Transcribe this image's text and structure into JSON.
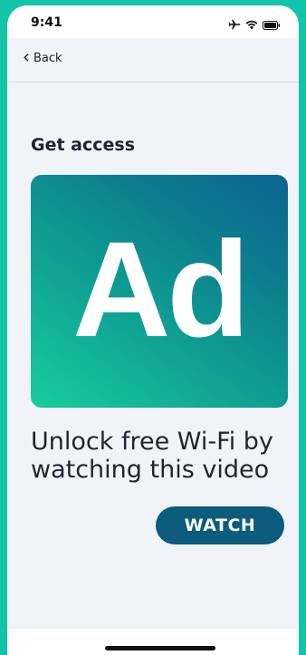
{
  "status_bar": {
    "time": "9:41",
    "icons": [
      "airplane-icon",
      "wifi-icon",
      "battery-icon"
    ]
  },
  "nav": {
    "back_label": "Back"
  },
  "main": {
    "title": "Get access",
    "ad_label": "Ad",
    "headline": "Unlock free Wi-Fi by watching this video",
    "watch_label": "WATCH"
  },
  "colors": {
    "frame": "#12c4aa",
    "background": "#f0f3f7",
    "button": "#0d5b7d",
    "card_gradient_start": "#18cc9c",
    "card_gradient_end": "#0b6592"
  }
}
